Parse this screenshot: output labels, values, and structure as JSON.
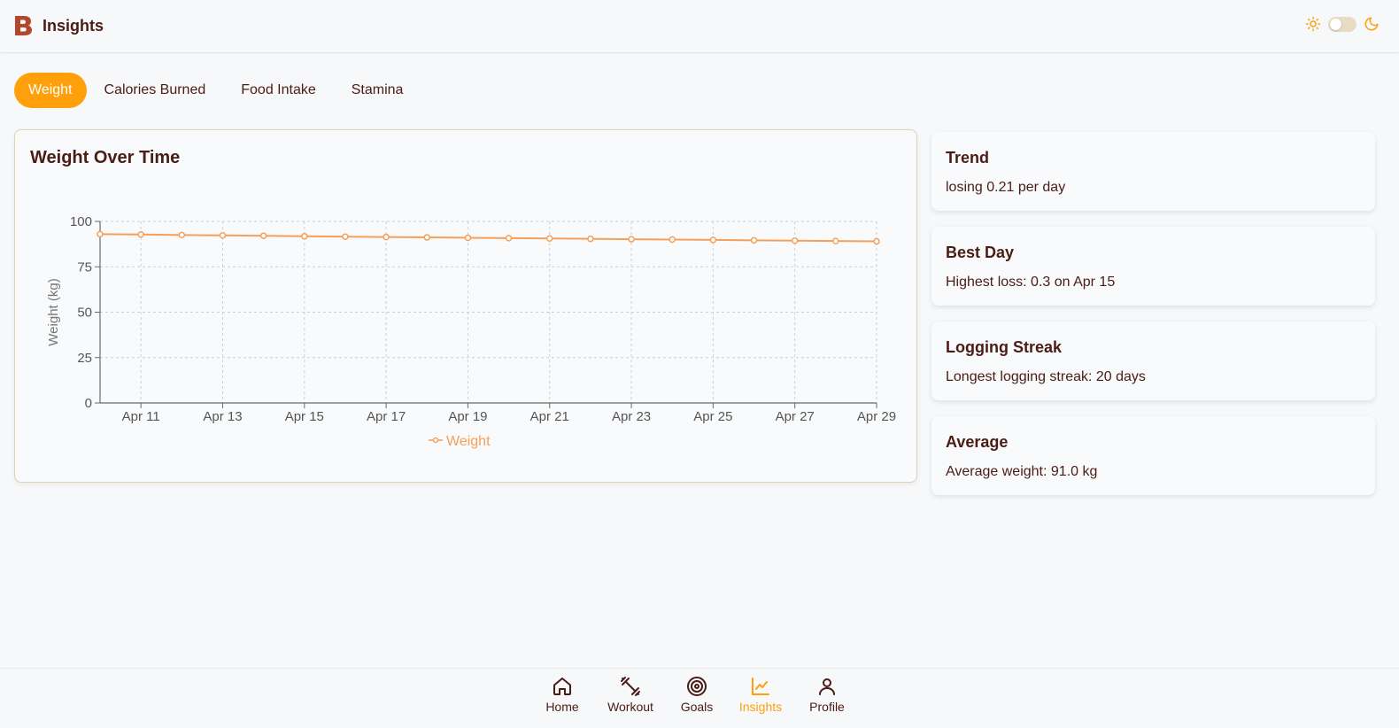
{
  "header": {
    "title": "Insights",
    "logo_letter": "B"
  },
  "tabs": [
    {
      "label": "Weight",
      "active": true
    },
    {
      "label": "Calories Burned",
      "active": false
    },
    {
      "label": "Food Intake",
      "active": false
    },
    {
      "label": "Stamina",
      "active": false
    }
  ],
  "chart_card": {
    "title": "Weight Over Time"
  },
  "chart_data": {
    "type": "line",
    "x": [
      "Apr 10",
      "Apr 11",
      "Apr 12",
      "Apr 13",
      "Apr 14",
      "Apr 15",
      "Apr 16",
      "Apr 17",
      "Apr 18",
      "Apr 19",
      "Apr 20",
      "Apr 21",
      "Apr 22",
      "Apr 23",
      "Apr 24",
      "Apr 25",
      "Apr 26",
      "Apr 27",
      "Apr 28",
      "Apr 29"
    ],
    "x_tick_labels": [
      "Apr 11",
      "Apr 13",
      "Apr 15",
      "Apr 17",
      "Apr 19",
      "Apr 21",
      "Apr 23",
      "Apr 25",
      "Apr 27",
      "Apr 29"
    ],
    "series": [
      {
        "name": "Weight",
        "values": [
          93.0,
          92.8,
          92.5,
          92.3,
          92.1,
          91.8,
          91.6,
          91.4,
          91.2,
          91.0,
          90.8,
          90.6,
          90.4,
          90.2,
          90.0,
          89.8,
          89.6,
          89.4,
          89.2,
          89.0
        ]
      }
    ],
    "ylabel": "Weight (kg)",
    "yticks": [
      0,
      25,
      50,
      75,
      100
    ],
    "ylim": [
      0,
      100
    ],
    "grid": true,
    "legend": "bottom",
    "color": "#f5a05a"
  },
  "stats": [
    {
      "title": "Trend",
      "text": "losing 0.21 per day"
    },
    {
      "title": "Best Day",
      "text": "Highest loss: 0.3 on Apr 15"
    },
    {
      "title": "Logging Streak",
      "text": "Longest logging streak: 20 days"
    },
    {
      "title": "Average",
      "text": "Average weight: 91.0 kg"
    }
  ],
  "nav": [
    {
      "label": "Home",
      "icon": "home-icon",
      "active": false
    },
    {
      "label": "Workout",
      "icon": "dumbbell-icon",
      "active": false
    },
    {
      "label": "Goals",
      "icon": "target-icon",
      "active": false
    },
    {
      "label": "Insights",
      "icon": "chart-icon",
      "active": true
    },
    {
      "label": "Profile",
      "icon": "user-icon",
      "active": false
    }
  ],
  "colors": {
    "accent": "#ff9f0a",
    "text": "#4a1c14",
    "logo": "#b5462e",
    "line": "#f5a05a"
  }
}
